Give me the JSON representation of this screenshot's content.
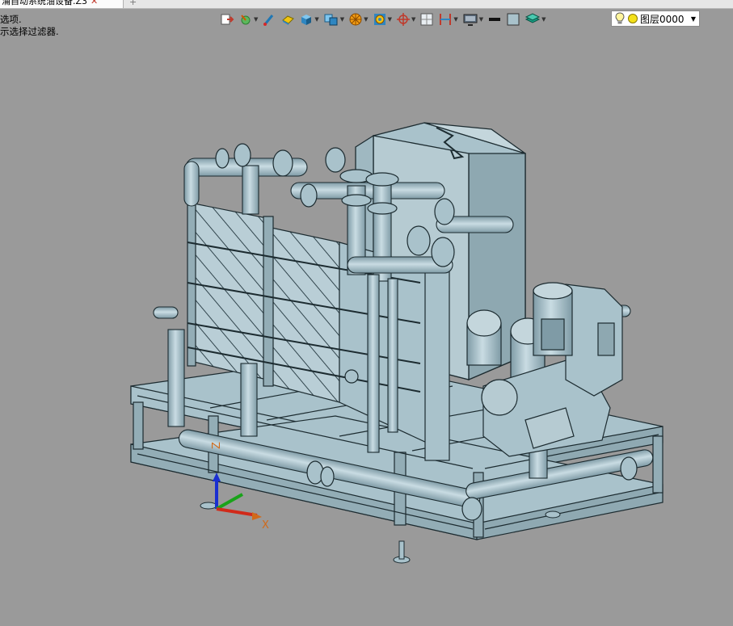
{
  "tab": {
    "title": "涌自动系统油设备.Z3",
    "close": "✕",
    "new_tab": "+"
  },
  "prompt": {
    "line1": "选项.",
    "line2": "示选择过滤器."
  },
  "toolbar": {
    "icons": [
      "exit-icon",
      "sketch-icon",
      "brush-icon",
      "eraser-icon",
      "cube-icon",
      "view-cube-icon",
      "wheel-icon",
      "target-icon",
      "crosshair-icon",
      "grid-icon",
      "dimension-icon",
      "monitor-icon",
      "line-style-icon",
      "color-swatch-icon",
      "layer-stack-icon"
    ],
    "layer": {
      "name": "图层0000",
      "bulb": "lightbulb-icon",
      "status": "layer-on-icon"
    }
  },
  "viewport": {
    "background": "#9a9a9a",
    "model_color": "#a9c2cb",
    "axis": {
      "x_label": "X",
      "z_label": "Z"
    }
  }
}
